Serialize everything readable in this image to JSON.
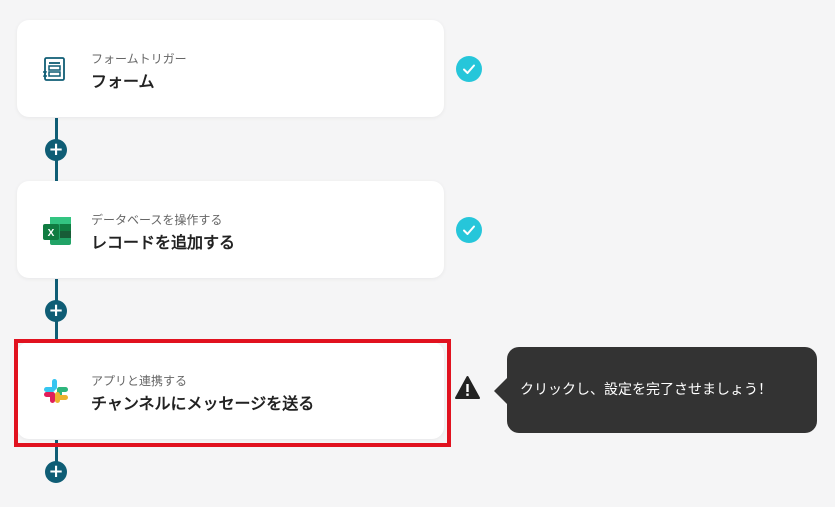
{
  "flow": {
    "steps": [
      {
        "subtitle": "フォームトリガー",
        "title": "フォーム",
        "icon": "form-trigger-icon",
        "status": "complete"
      },
      {
        "subtitle": "データベースを操作する",
        "title": "レコードを追加する",
        "icon": "excel-icon",
        "status": "complete"
      },
      {
        "subtitle": "アプリと連携する",
        "title": "チャンネルにメッセージを送る",
        "icon": "slack-icon",
        "status": "warning"
      }
    ]
  },
  "tooltip": {
    "text": "クリックし、設定を完了させましょう！"
  },
  "colors": {
    "connector": "#0f5d75",
    "check": "#26c6da",
    "highlight": "#e1121f",
    "tooltip_bg": "#333333"
  },
  "icons": {
    "add": "plus-icon",
    "complete": "check-icon",
    "warning": "warning-icon"
  }
}
